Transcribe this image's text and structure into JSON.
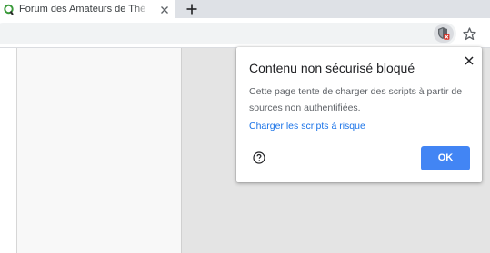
{
  "tab": {
    "title": "Forum des Amateurs de Thé - Co",
    "favicon": "q-logo-icon",
    "close_icon": "close-icon"
  },
  "toolbar": {
    "newtab_icon": "plus-icon",
    "blocked_icon": "shield-blocked-icon",
    "star_icon": "star-icon"
  },
  "popup": {
    "title": "Contenu non sécurisé bloqué",
    "body": "Cette page tente de charger des scripts à partir de sources non authentifiées.",
    "link": "Charger les scripts à risque",
    "ok_label": "OK",
    "help_icon": "help-icon",
    "close_icon": "close-icon"
  },
  "colors": {
    "accent": "#4285f4",
    "link": "#1a73e8",
    "tabstrip": "#dee1e6",
    "blocked_badge": "#d93025"
  }
}
